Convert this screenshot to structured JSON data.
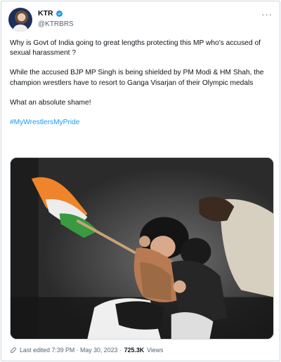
{
  "author": {
    "display_name": "KTR",
    "handle": "@KTRBRS"
  },
  "tweet": {
    "paragraphs": [
      "Why is Govt of India going to great lengths protecting this MP who’s accused of sexual harassment ?",
      "While the accused BJP MP Singh is being shielded by PM Modi & HM Shah, the champion wrestlers have to resort to Ganga Visarjan of their Olympic medals",
      "What an absolute shame!"
    ],
    "hashtag": "#MyWrestlersMyPride"
  },
  "footer": {
    "edited_label": "Last edited 7:39 PM · May 30, 2023 ·",
    "views_count": "725.3K",
    "views_label": "Views"
  },
  "colors": {
    "accent": "#1d9bf0",
    "secondary_text": "#536471"
  },
  "icons": {
    "verified": "verified-badge-icon",
    "more": "more-options-icon",
    "edit": "edit-pencil-icon"
  }
}
